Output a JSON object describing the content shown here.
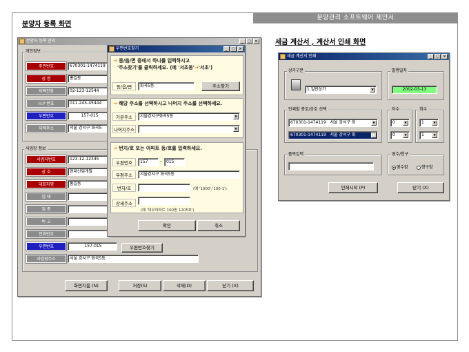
{
  "page": {
    "banner": "분양관리 소프트웨어 제안서",
    "heading_left": "분양자 등록 화면",
    "heading_right": "세금 계산서 , 계산서 인쇄 화면"
  },
  "main_window": {
    "title": "분양자 등록 관리",
    "personal_group": "개인정보",
    "personal": [
      {
        "label": "주민번호",
        "value": "670301-1474119",
        "style": "red"
      },
      {
        "label": "성   명",
        "value": "홍길동",
        "style": "red"
      },
      {
        "label": "자택전화",
        "value": "02-123-12544",
        "style": "gray"
      },
      {
        "label": "H.P 번호",
        "value": "011-245-45444",
        "style": "gray"
      },
      {
        "label": "우편번호",
        "value": "157-015",
        "style": "blue"
      },
      {
        "label": "자택주소",
        "value": "서울 강서구 화곡5",
        "style": "gray"
      }
    ],
    "business_group": "사업장 정보",
    "business": [
      {
        "label": "사업자번호",
        "value": "123-12-12345",
        "style": "red"
      },
      {
        "label": "상   호",
        "value": "현대산업개발",
        "style": "red"
      },
      {
        "label": "대표자명",
        "value": "홍길동",
        "style": "red"
      },
      {
        "label": "업   태",
        "value": "",
        "style": "gray"
      },
      {
        "label": "업   종",
        "value": "",
        "style": "gray"
      },
      {
        "label": "비   고",
        "value": "",
        "style": "gray"
      },
      {
        "label": "전화번호",
        "value": "",
        "style": "gray"
      },
      {
        "label": "우편번호",
        "value": "157-015",
        "style": "blue"
      },
      {
        "label": "사업장주소",
        "value": "서울 강서구 화곡5동",
        "style": "gray"
      }
    ],
    "zip_search_button": "우편번호찾기",
    "buttons": {
      "reset": "화면지움 (N)",
      "save": "저장(S)",
      "delete": "삭제(D)",
      "close": "닫기 (X)"
    }
  },
  "zip_dialog": {
    "title": "우편번호찾기",
    "step1_line1": "동/읍/면 중에서 하나를 입력하시고",
    "step1_line2": "'주소찾기'를 클릭하세요. (예 '서초동'",
    "step1_line2_tail": "'서초')",
    "dong_label": "동/읍/면",
    "dong_value": "화곡5동",
    "find_button": "주소찾기",
    "step2": "해당 주소를 선택하시고 나머지 주소를 선택하세요.",
    "basic_addr_label": "기본주소",
    "basic_addr_value": "서울강서구화곡5동",
    "rest_addr_label": "나머지주소",
    "rest_addr_value": "",
    "step3": "번지/호 또는 아파트 동/호를 입력하세요.",
    "zip_label": "우편번호",
    "zip1": "157",
    "zip_sep": "-",
    "zip2": "015",
    "addr_label": "우편주소",
    "addr_value": "서울강서구 화곡5동",
    "bunji_label": "번지/호",
    "bunji_hint": "(예 '1000','100-1')",
    "detail_label": "상세주소",
    "detail_hint": "(예 '대우아파트 100동 1205호')",
    "ok": "확인",
    "cancel": "취소"
  },
  "print_window": {
    "title": "세금 계산서 인쇄",
    "shop_group": "상가구분",
    "shop_value": "1.일반상가",
    "issue_date_group": "발행일자",
    "issue_date": "2002-03-13",
    "select_group": "인쇄할 층호/상호 선택",
    "row1_id": "670301-1474119",
    "row1_addr": "서울 강서구 화",
    "row2_id": "670301-1474119",
    "row2_addr": "서울 강서구 화",
    "round_group": "차수",
    "round1": "0",
    "round2": "0",
    "count_group": "회수",
    "count1": "1",
    "count2": "1",
    "item_group": "품목입력",
    "receipt_group": "영수/청구",
    "receipt_opt1": "영수함",
    "receipt_opt2": "청구함",
    "print_button": "인쇄시작 (P)",
    "close_button": "닫기 (X)"
  }
}
